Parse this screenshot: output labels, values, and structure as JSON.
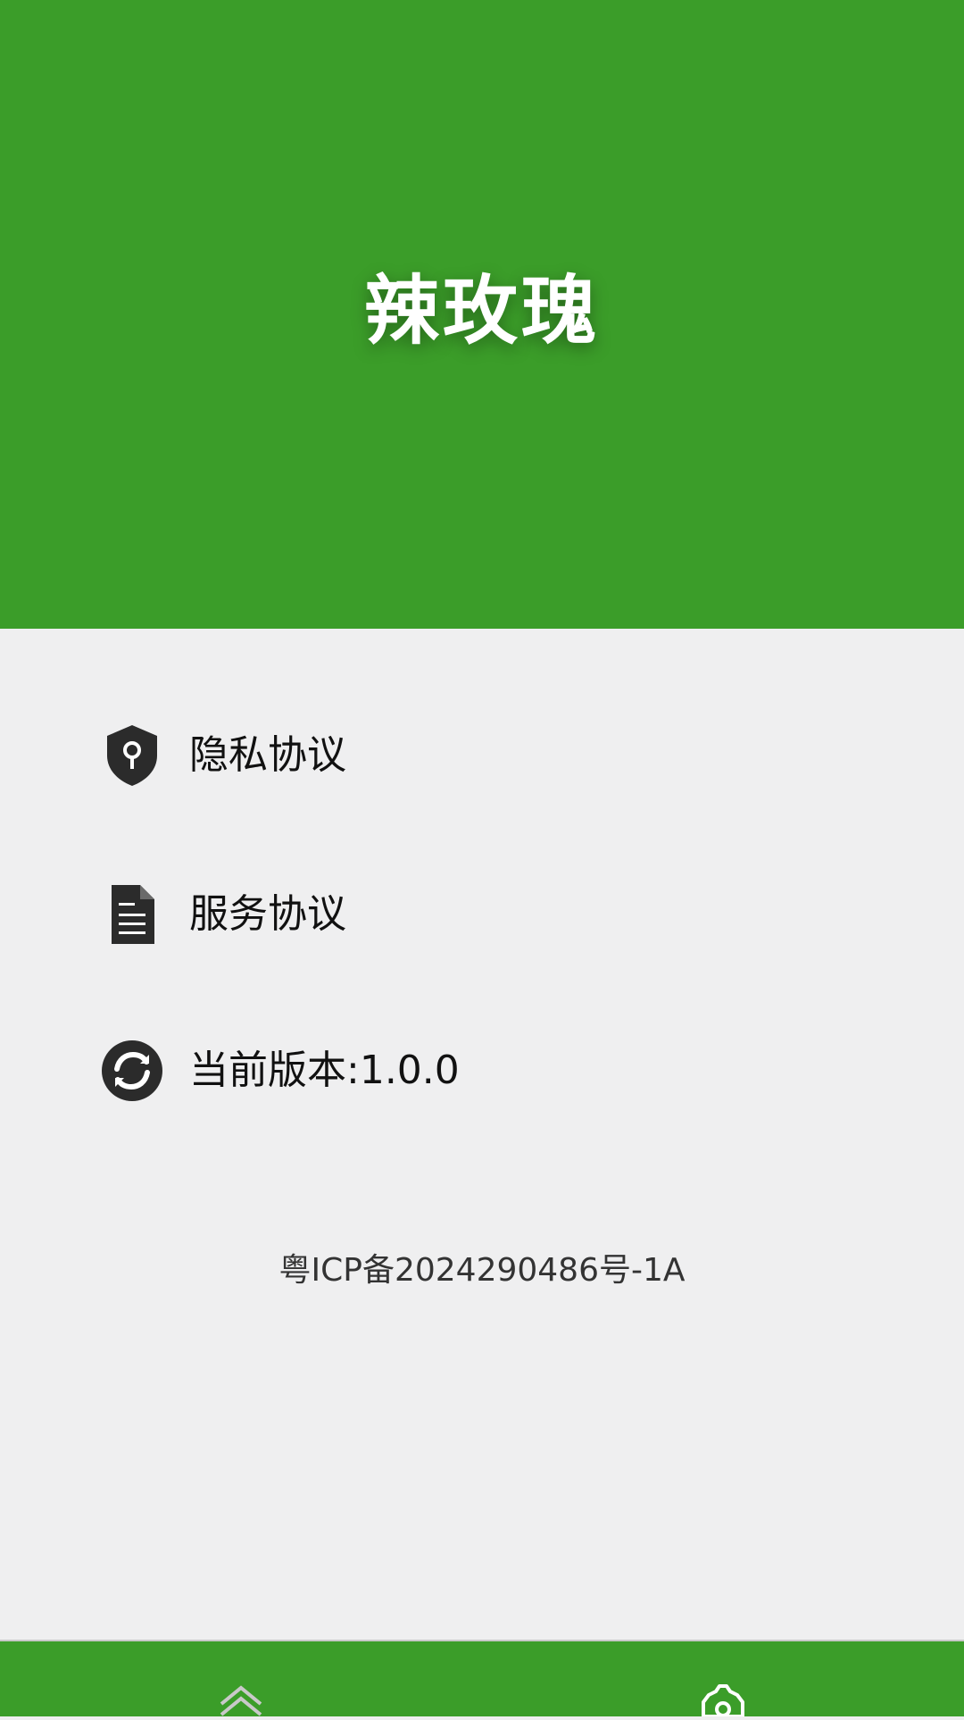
{
  "header": {
    "title": "辣玫瑰",
    "background_color": "#3b9d29"
  },
  "menu": {
    "items": [
      {
        "label": "隐私协议",
        "icon": "shield-lock-icon"
      },
      {
        "label": "服务协议",
        "icon": "document-icon"
      },
      {
        "label": "当前版本:1.0.0",
        "icon": "refresh-icon"
      }
    ]
  },
  "footer": {
    "icp": "粤ICP备2024290486号-1A"
  },
  "bottom_nav": {
    "background_color": "#3b9d29",
    "tabs": [
      {
        "icon": "double-chevron-up-icon"
      },
      {
        "icon": "gear-icon"
      }
    ]
  }
}
